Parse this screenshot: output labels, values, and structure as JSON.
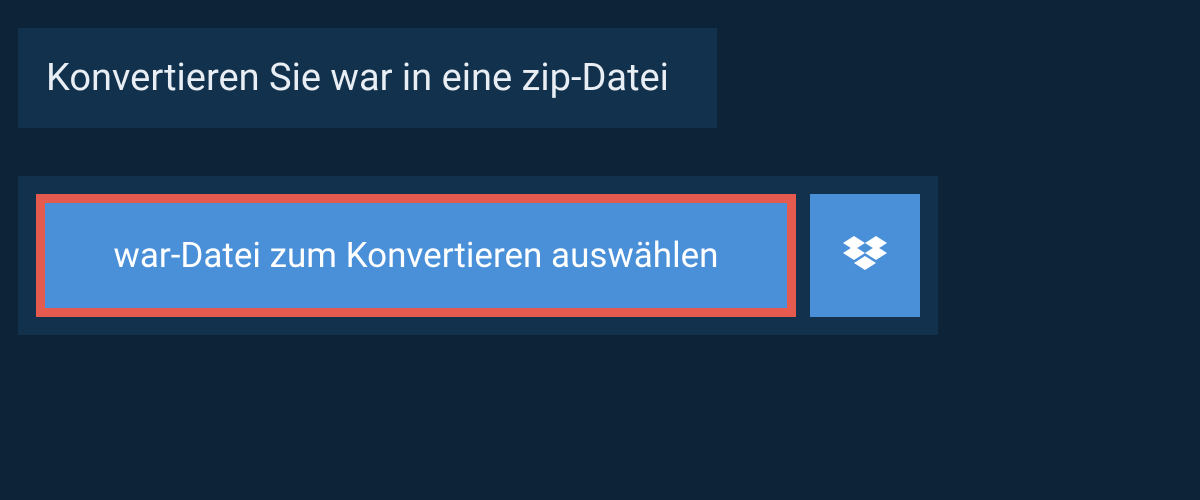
{
  "title": "Konvertieren Sie war in eine zip-Datei",
  "upload": {
    "select_label": "war-Datei zum Konvertieren auswählen"
  },
  "colors": {
    "background": "#0d2438",
    "panel": "#11314d",
    "button": "#4a90d9",
    "highlight_border": "#e55a4f",
    "text_light": "#e8eef3",
    "text_white": "#ffffff"
  }
}
